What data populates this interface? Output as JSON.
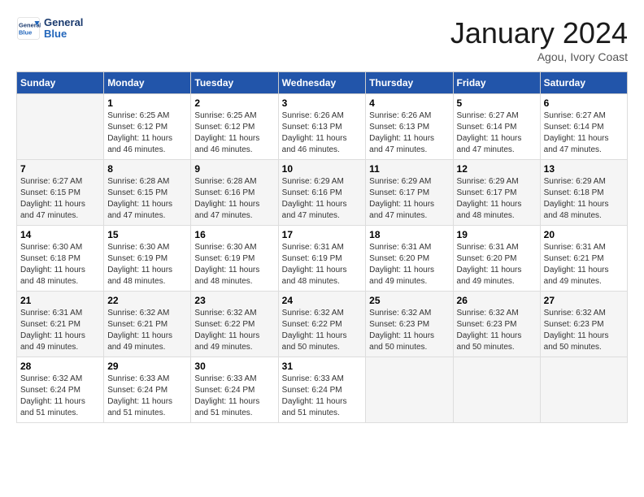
{
  "header": {
    "logo_general": "General",
    "logo_blue": "Blue",
    "month": "January 2024",
    "location": "Agou, Ivory Coast"
  },
  "weekdays": [
    "Sunday",
    "Monday",
    "Tuesday",
    "Wednesday",
    "Thursday",
    "Friday",
    "Saturday"
  ],
  "weeks": [
    [
      {
        "day": "",
        "info": ""
      },
      {
        "day": "1",
        "info": "Sunrise: 6:25 AM\nSunset: 6:12 PM\nDaylight: 11 hours\nand 46 minutes."
      },
      {
        "day": "2",
        "info": "Sunrise: 6:25 AM\nSunset: 6:12 PM\nDaylight: 11 hours\nand 46 minutes."
      },
      {
        "day": "3",
        "info": "Sunrise: 6:26 AM\nSunset: 6:13 PM\nDaylight: 11 hours\nand 46 minutes."
      },
      {
        "day": "4",
        "info": "Sunrise: 6:26 AM\nSunset: 6:13 PM\nDaylight: 11 hours\nand 47 minutes."
      },
      {
        "day": "5",
        "info": "Sunrise: 6:27 AM\nSunset: 6:14 PM\nDaylight: 11 hours\nand 47 minutes."
      },
      {
        "day": "6",
        "info": "Sunrise: 6:27 AM\nSunset: 6:14 PM\nDaylight: 11 hours\nand 47 minutes."
      }
    ],
    [
      {
        "day": "7",
        "info": "Sunrise: 6:27 AM\nSunset: 6:15 PM\nDaylight: 11 hours\nand 47 minutes."
      },
      {
        "day": "8",
        "info": "Sunrise: 6:28 AM\nSunset: 6:15 PM\nDaylight: 11 hours\nand 47 minutes."
      },
      {
        "day": "9",
        "info": "Sunrise: 6:28 AM\nSunset: 6:16 PM\nDaylight: 11 hours\nand 47 minutes."
      },
      {
        "day": "10",
        "info": "Sunrise: 6:29 AM\nSunset: 6:16 PM\nDaylight: 11 hours\nand 47 minutes."
      },
      {
        "day": "11",
        "info": "Sunrise: 6:29 AM\nSunset: 6:17 PM\nDaylight: 11 hours\nand 47 minutes."
      },
      {
        "day": "12",
        "info": "Sunrise: 6:29 AM\nSunset: 6:17 PM\nDaylight: 11 hours\nand 48 minutes."
      },
      {
        "day": "13",
        "info": "Sunrise: 6:29 AM\nSunset: 6:18 PM\nDaylight: 11 hours\nand 48 minutes."
      }
    ],
    [
      {
        "day": "14",
        "info": "Sunrise: 6:30 AM\nSunset: 6:18 PM\nDaylight: 11 hours\nand 48 minutes."
      },
      {
        "day": "15",
        "info": "Sunrise: 6:30 AM\nSunset: 6:19 PM\nDaylight: 11 hours\nand 48 minutes."
      },
      {
        "day": "16",
        "info": "Sunrise: 6:30 AM\nSunset: 6:19 PM\nDaylight: 11 hours\nand 48 minutes."
      },
      {
        "day": "17",
        "info": "Sunrise: 6:31 AM\nSunset: 6:19 PM\nDaylight: 11 hours\nand 48 minutes."
      },
      {
        "day": "18",
        "info": "Sunrise: 6:31 AM\nSunset: 6:20 PM\nDaylight: 11 hours\nand 49 minutes."
      },
      {
        "day": "19",
        "info": "Sunrise: 6:31 AM\nSunset: 6:20 PM\nDaylight: 11 hours\nand 49 minutes."
      },
      {
        "day": "20",
        "info": "Sunrise: 6:31 AM\nSunset: 6:21 PM\nDaylight: 11 hours\nand 49 minutes."
      }
    ],
    [
      {
        "day": "21",
        "info": "Sunrise: 6:31 AM\nSunset: 6:21 PM\nDaylight: 11 hours\nand 49 minutes."
      },
      {
        "day": "22",
        "info": "Sunrise: 6:32 AM\nSunset: 6:21 PM\nDaylight: 11 hours\nand 49 minutes."
      },
      {
        "day": "23",
        "info": "Sunrise: 6:32 AM\nSunset: 6:22 PM\nDaylight: 11 hours\nand 49 minutes."
      },
      {
        "day": "24",
        "info": "Sunrise: 6:32 AM\nSunset: 6:22 PM\nDaylight: 11 hours\nand 50 minutes."
      },
      {
        "day": "25",
        "info": "Sunrise: 6:32 AM\nSunset: 6:23 PM\nDaylight: 11 hours\nand 50 minutes."
      },
      {
        "day": "26",
        "info": "Sunrise: 6:32 AM\nSunset: 6:23 PM\nDaylight: 11 hours\nand 50 minutes."
      },
      {
        "day": "27",
        "info": "Sunrise: 6:32 AM\nSunset: 6:23 PM\nDaylight: 11 hours\nand 50 minutes."
      }
    ],
    [
      {
        "day": "28",
        "info": "Sunrise: 6:32 AM\nSunset: 6:24 PM\nDaylight: 11 hours\nand 51 minutes."
      },
      {
        "day": "29",
        "info": "Sunrise: 6:33 AM\nSunset: 6:24 PM\nDaylight: 11 hours\nand 51 minutes."
      },
      {
        "day": "30",
        "info": "Sunrise: 6:33 AM\nSunset: 6:24 PM\nDaylight: 11 hours\nand 51 minutes."
      },
      {
        "day": "31",
        "info": "Sunrise: 6:33 AM\nSunset: 6:24 PM\nDaylight: 11 hours\nand 51 minutes."
      },
      {
        "day": "",
        "info": ""
      },
      {
        "day": "",
        "info": ""
      },
      {
        "day": "",
        "info": ""
      }
    ]
  ]
}
